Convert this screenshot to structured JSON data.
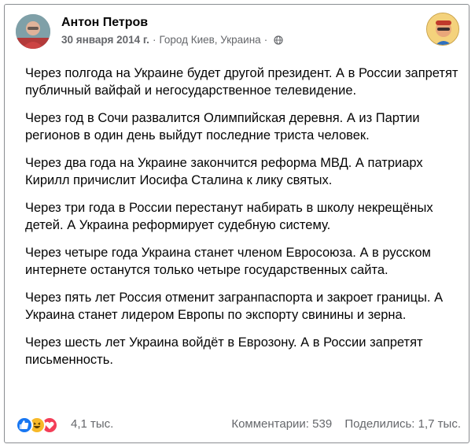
{
  "post": {
    "author": "Антон Петров",
    "date": "30 января 2014 г.",
    "location": "Город Киев, Украина",
    "meta_sep_1": "·",
    "meta_sep_2": "·",
    "privacy_icon": "globe-icon",
    "paragraphs": [
      "Через полгода на Украине будет другой президент. А в России запретят публичный вайфай и негосударственное телевидение.",
      "Через год в Сочи развалится Олимпийская деревня. А из Партии регионов в один день выйдут последние триста человек.",
      "Через два года на Украине закончится реформа МВД. А патриарх Кирилл причислит Иосифа Сталина к лику святых.",
      "Через три года в России перестанут набирать в школу некрещёных детей. А Украина реформирует судебную систему.",
      "Через четыре года Украина станет членом Евросоюза. А в русском интернете останутся только четыре государственных сайта.",
      "Через пять лет Россия отменит загранпаспорта и закроет границы. А Украина станет лидером Европы по экспорту свинины и зерна.",
      "Через шесть лет Украина войдёт в Еврозону. А в России запретят письменность."
    ]
  },
  "footer": {
    "reactions": [
      "like-icon",
      "haha-icon",
      "love-icon"
    ],
    "reaction_count": "4,1 тыс.",
    "comments": "Комментарии: 539",
    "shares": "Поделились: 1,7 тыс."
  },
  "colors": {
    "like": "#1877f2",
    "haha": "#f7b928",
    "love": "#f33e58",
    "secondary_text": "#65676b"
  }
}
